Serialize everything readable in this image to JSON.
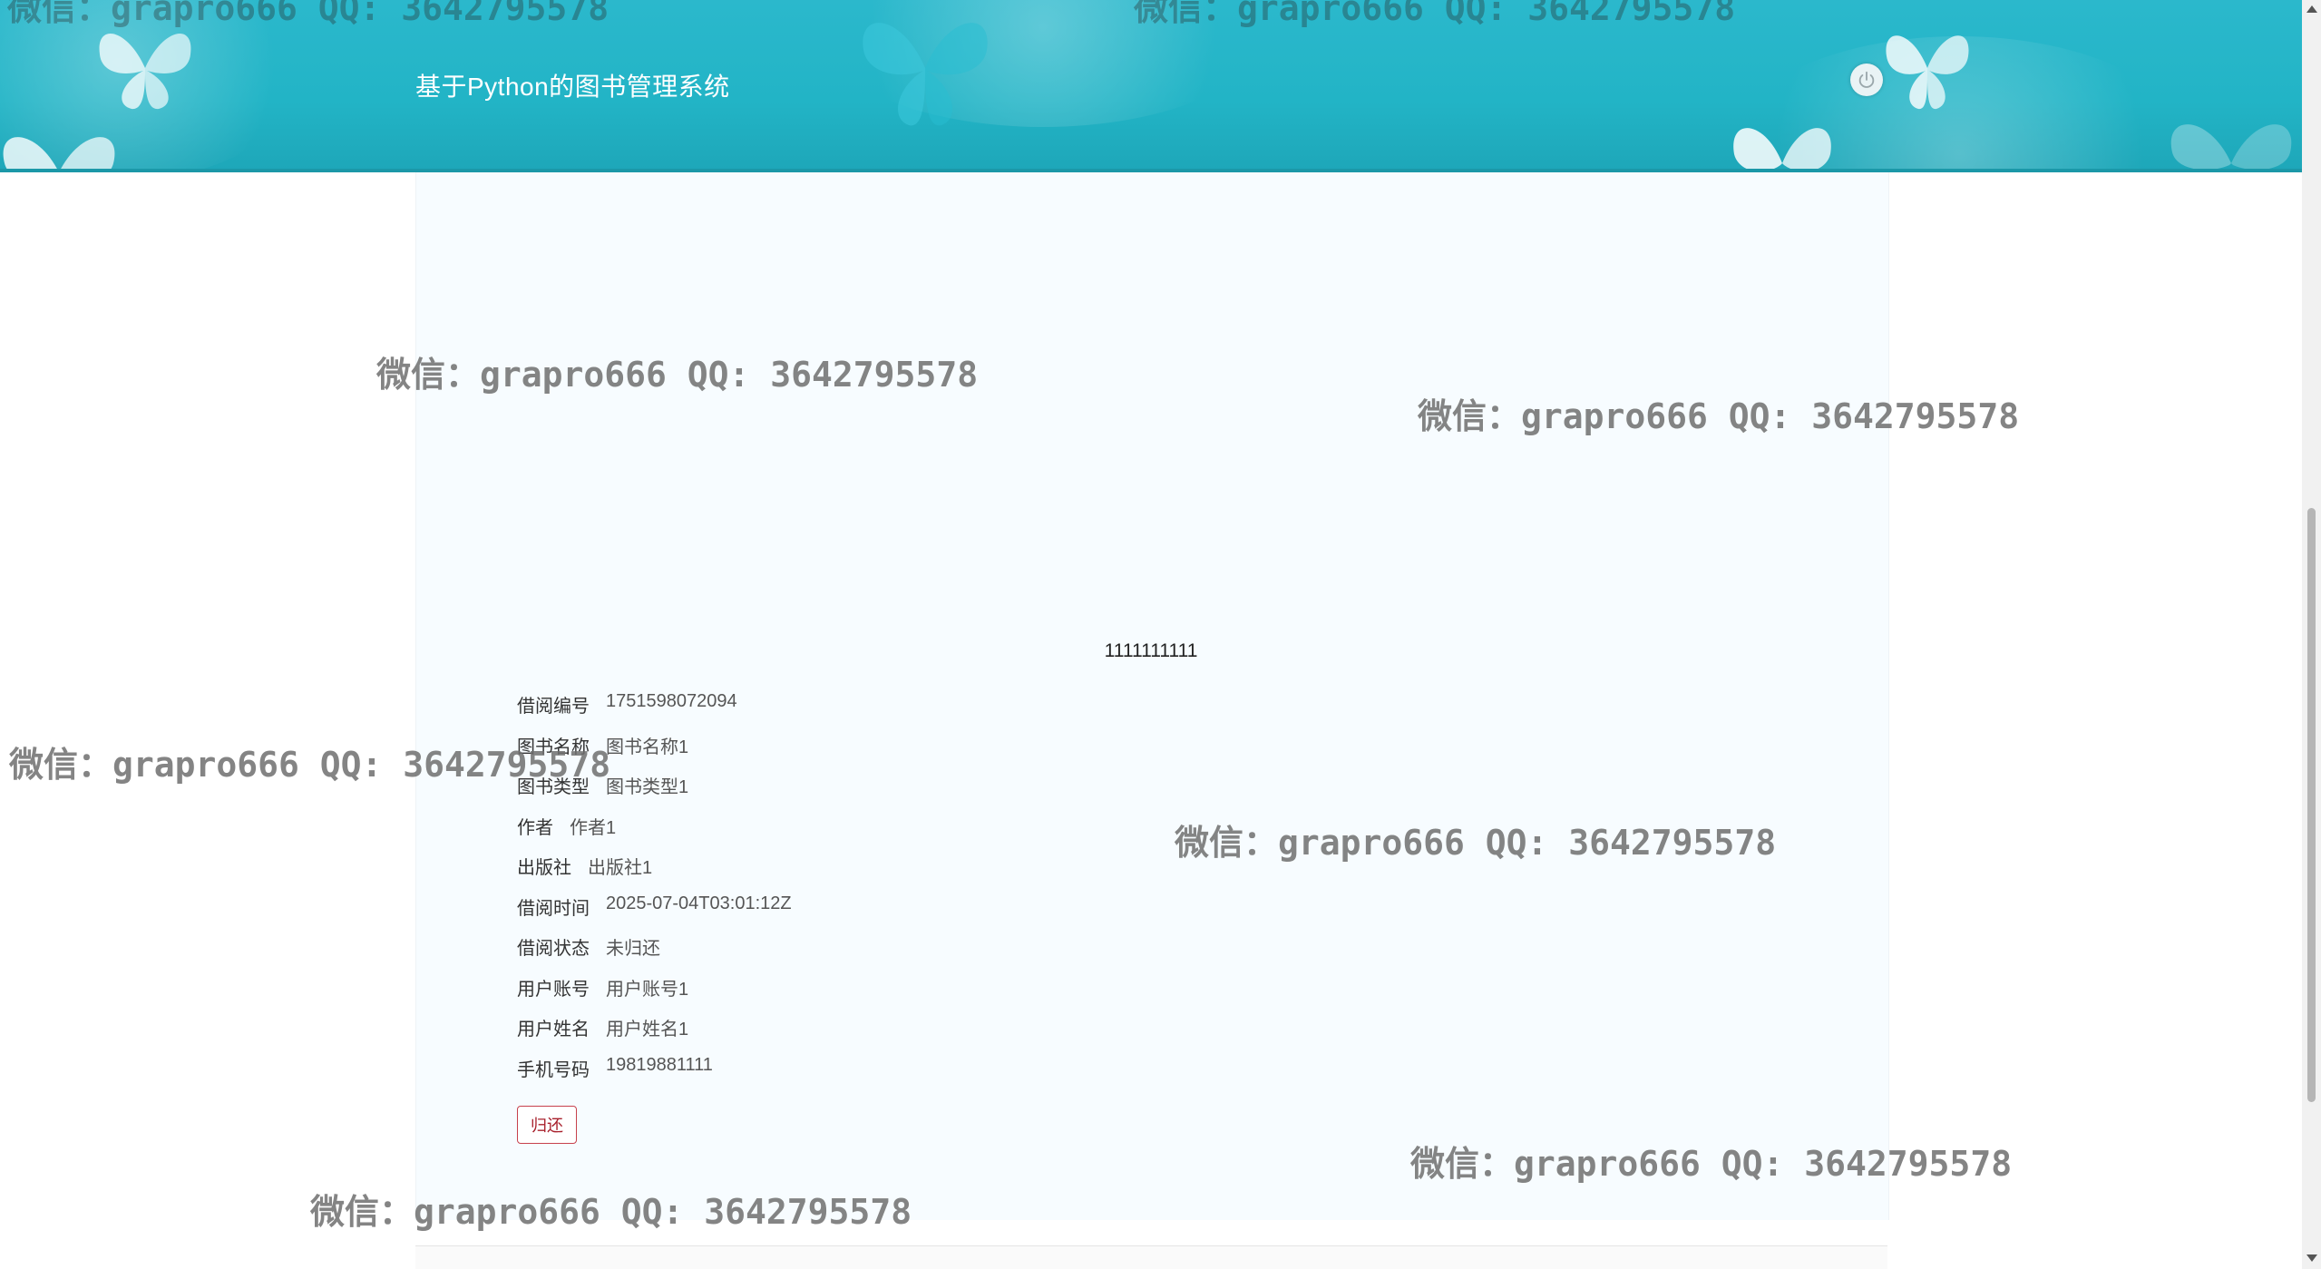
{
  "header": {
    "title": "基于Python的图书管理系统"
  },
  "detail": {
    "title": "1111111111",
    "fields": [
      {
        "label": "借阅编号",
        "value": "1751598072094"
      },
      {
        "label": "图书名称",
        "value": "图书名称1"
      },
      {
        "label": "图书类型",
        "value": "图书类型1"
      },
      {
        "label": "作者",
        "value": "作者1"
      },
      {
        "label": "出版社",
        "value": "出版社1"
      },
      {
        "label": "借阅时间",
        "value": "2025-07-04T03:01:12Z"
      },
      {
        "label": "借阅状态",
        "value": "未归还"
      },
      {
        "label": "用户账号",
        "value": "用户账号1"
      },
      {
        "label": "用户姓名",
        "value": "用户姓名1"
      },
      {
        "label": "手机号码",
        "value": "19819881111"
      }
    ],
    "return_label": "归还"
  },
  "watermark": {
    "text": "微信：grapro666 QQ: 3642795578"
  },
  "icons": {
    "power": "power-icon",
    "butterfly": "butterfly-icon"
  },
  "colors": {
    "header": "#22b4c6",
    "panel": "#f7fcff",
    "button_border": "#c7414d"
  }
}
